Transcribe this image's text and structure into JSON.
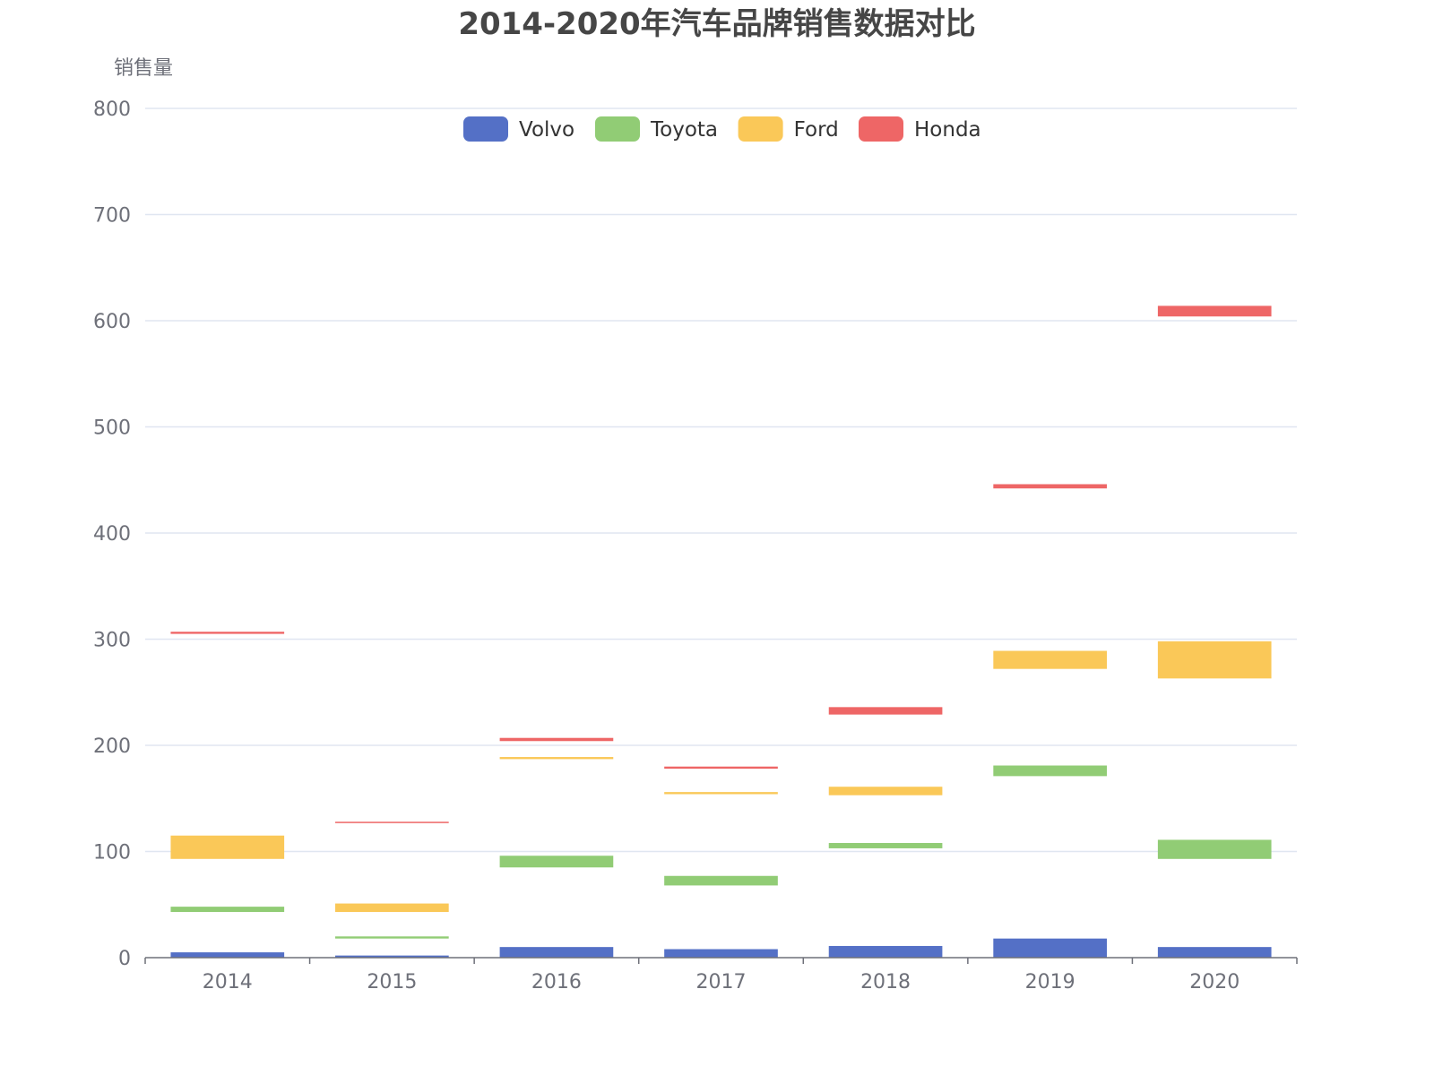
{
  "chart_data": {
    "type": "bar",
    "title": "2014-2020年汽车品牌销售数据对比",
    "ylabel": "销售量",
    "xlabel": "",
    "categories": [
      "2014",
      "2015",
      "2016",
      "2017",
      "2018",
      "2019",
      "2020"
    ],
    "ylim": [
      0,
      800
    ],
    "yticks": [
      0,
      100,
      200,
      300,
      400,
      500,
      600,
      700,
      800
    ],
    "grid": true,
    "legend_position": "top-center",
    "series": [
      {
        "name": "Volvo",
        "color": "#5470c6",
        "ranges": [
          [
            0,
            5
          ],
          [
            0,
            2
          ],
          [
            0,
            10
          ],
          [
            0,
            8
          ],
          [
            0,
            11
          ],
          [
            0,
            18
          ],
          [
            0,
            10
          ]
        ]
      },
      {
        "name": "Toyota",
        "color": "#91cc75",
        "ranges": [
          [
            43,
            48
          ],
          [
            18,
            20
          ],
          [
            85,
            96
          ],
          [
            68,
            77
          ],
          [
            103,
            108
          ],
          [
            171,
            181
          ],
          [
            93,
            111
          ]
        ]
      },
      {
        "name": "Ford",
        "color": "#fac858",
        "ranges": [
          [
            93,
            115
          ],
          [
            43,
            51
          ],
          [
            187,
            189
          ],
          [
            154,
            156
          ],
          [
            153,
            161
          ],
          [
            272,
            289
          ],
          [
            263,
            298
          ]
        ]
      },
      {
        "name": "Honda",
        "color": "#ee6666",
        "ranges": [
          [
            305,
            307
          ],
          [
            127,
            128
          ],
          [
            204,
            207
          ],
          [
            178,
            180
          ],
          [
            229,
            236
          ],
          [
            442,
            446
          ],
          [
            604,
            614
          ]
        ]
      }
    ]
  }
}
